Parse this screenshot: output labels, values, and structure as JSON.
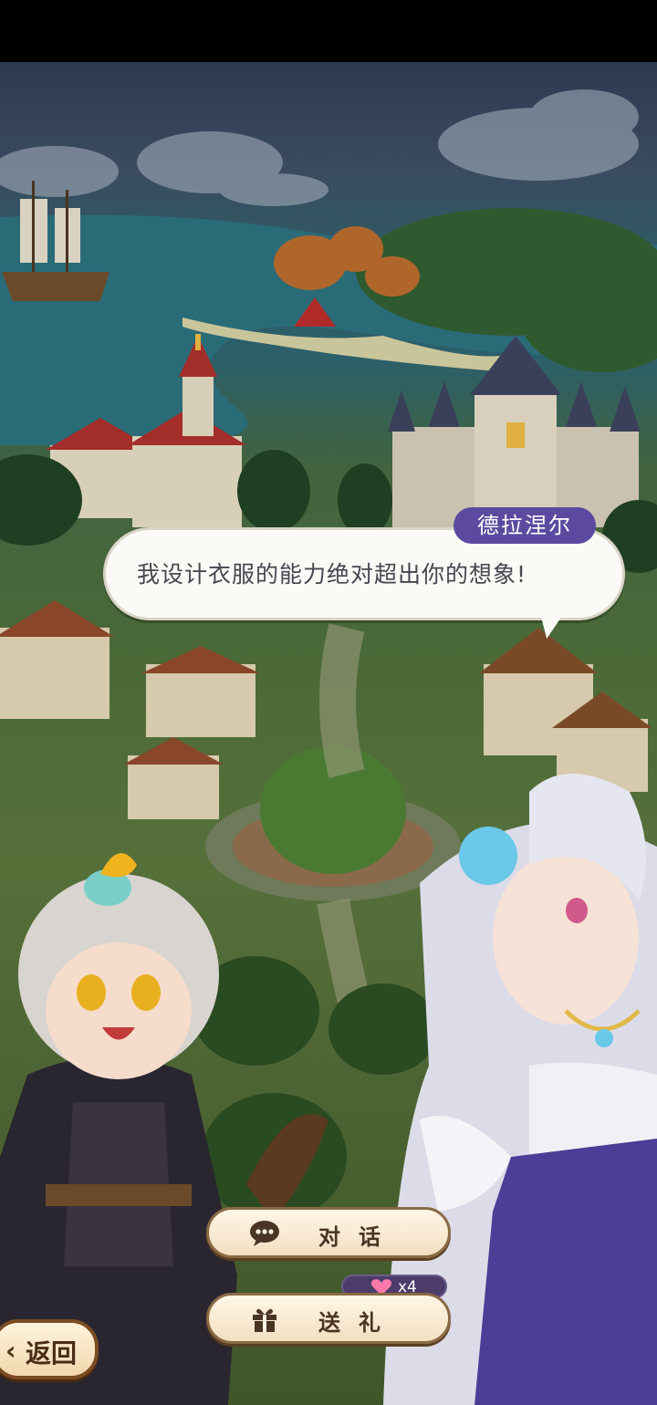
{
  "dialogue": {
    "speaker": "德拉涅尔",
    "text": "我设计衣服的能力绝对超出你的想象!"
  },
  "actions": {
    "talk_label": "对话",
    "gift_label": "送礼",
    "gift_count": "x4"
  },
  "nav": {
    "back_label": "返回"
  },
  "icons": {
    "talk": "chat-bubble-icon",
    "gift": "gift-box-icon",
    "affection": "heart-icon",
    "back": "chevron-left-icon"
  },
  "colors": {
    "name_tag": "#5b4aa0",
    "button_fill": "#f3dfc2",
    "button_border": "#8a6a44",
    "heart": "#ff7aa8"
  }
}
